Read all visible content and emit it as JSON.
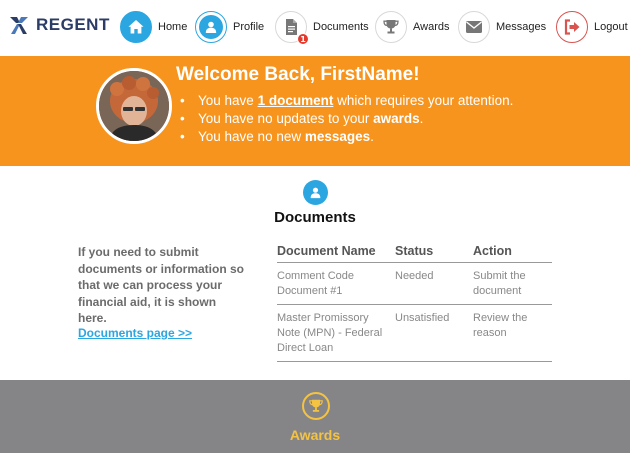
{
  "brand": {
    "name": "REGENT"
  },
  "nav": {
    "home": "Home",
    "profile": "Profile",
    "documents": "Documents",
    "documents_badge": "1",
    "awards": "Awards",
    "messages": "Messages",
    "logout": "Logout"
  },
  "welcome": {
    "title": "Welcome Back, FirstName!",
    "line1_pre": "You have ",
    "line1_link": "1 document",
    "line1_post": " which requires your attention.",
    "line2_pre": "You have no updates to your ",
    "line2_bold": "awards",
    "line2_post": ".",
    "line3_pre": "You have no new ",
    "line3_bold": "messages",
    "line3_post": "."
  },
  "documents": {
    "title": "Documents",
    "description": "If you need to submit documents or information so that we can process your financial aid, it is shown here.",
    "link": "Documents page >>",
    "columns": [
      "Document Name",
      "Status",
      "Action"
    ],
    "rows": [
      {
        "name": "Comment Code Document #1",
        "status": "Needed",
        "action": "Submit the document"
      },
      {
        "name": "Master Promissory Note (MPN) - Federal Direct Loan",
        "status": "Unsatisfied",
        "action": "Review the reason"
      }
    ]
  },
  "awards": {
    "title": "Awards"
  },
  "colors": {
    "accent_blue": "#2ba6e1",
    "banner_orange": "#f7941d",
    "awards_gray": "#858588",
    "awards_gold": "#f5c342",
    "logout_red": "#d9534f",
    "badge_red": "#e23b2e"
  },
  "icons": {
    "home": "home-icon",
    "profile": "user-icon",
    "documents": "document-icon",
    "awards": "trophy-icon",
    "messages": "envelope-icon",
    "logout": "logout-icon"
  }
}
